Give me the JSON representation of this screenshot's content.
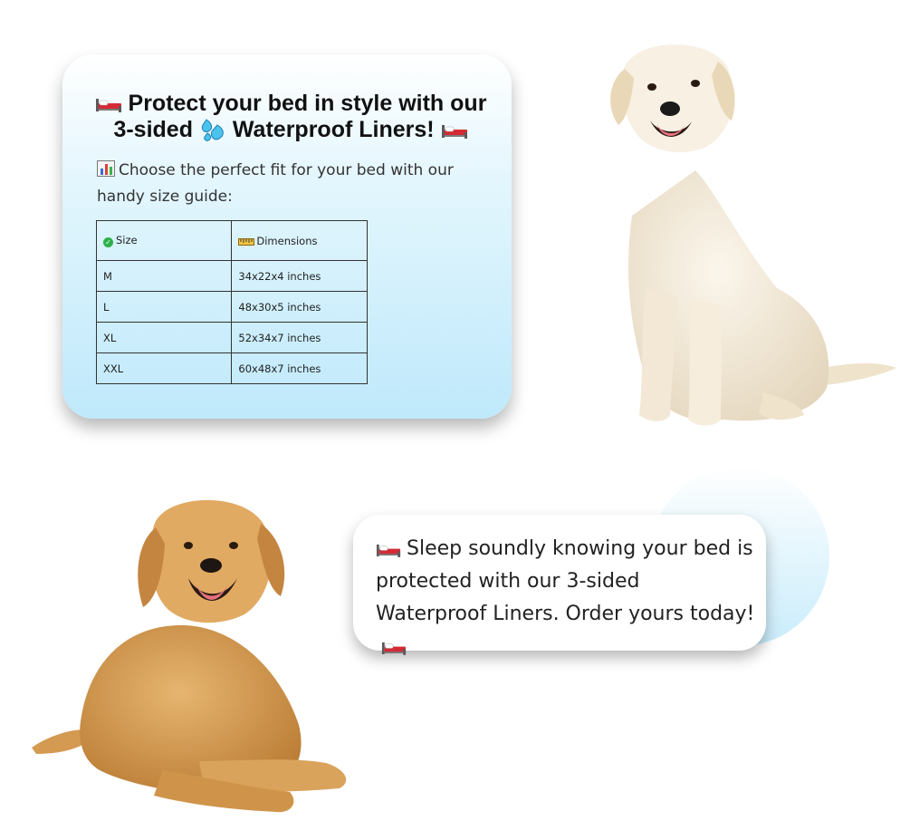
{
  "top_card": {
    "title_line1": "Protect your bed in style with our",
    "title_line2_part1": "3-sided",
    "title_line2_part2": "Waterproof Liners!",
    "subtitle": "Choose the perfect fit for your bed with our handy size guide:",
    "icons": [
      "bed-emoji-icon",
      "water-drops-icon",
      "bar-chart-icon"
    ],
    "table": {
      "headers": [
        "Size",
        "Dimensions"
      ],
      "rows": [
        [
          "M",
          "34x22x4 inches"
        ],
        [
          "L",
          "48x30x5 inches"
        ],
        [
          "XL",
          "52x34x7 inches"
        ],
        [
          "XXL",
          "60x48x7 inches"
        ]
      ]
    }
  },
  "bottom_card": {
    "text": "Sleep soundly knowing your bed is protected with our 3-sided Waterproof Liners. Order yours today!"
  },
  "colors": {
    "card_gradient_top": "#ffffff",
    "card_gradient_bottom": "#bfe9fb",
    "check_green": "#2db14a",
    "golden_dog": "#d9a35c",
    "white_dog": "#f3ead8"
  }
}
